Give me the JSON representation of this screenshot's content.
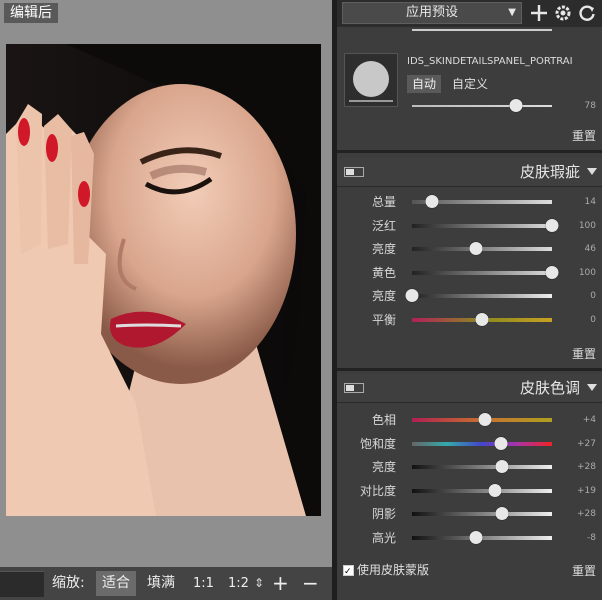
{
  "left": {
    "view_label": "编辑后",
    "zoom_label": "缩放:",
    "zoom_fit": "适合",
    "zoom_fill": "填满",
    "zoom_1_1": "1:1",
    "zoom_1_2": "1:2"
  },
  "toolbar": {
    "preset_label": "应用预设",
    "icons": [
      "plus-icon",
      "gear-icon",
      "refresh-icon"
    ]
  },
  "portrait_panel": {
    "title": "IDS_SKINDETAILSPANEL_PORTRAI",
    "auto_label": "自动",
    "custom_label": "自定义",
    "value": "78",
    "reset_label": "重置"
  },
  "blemish_panel": {
    "title": "皮肤瑕疵",
    "rows": [
      {
        "label": "总量",
        "value": "14",
        "pos": 0.14
      },
      {
        "label": "泛红",
        "value": "100",
        "pos": 1.0
      },
      {
        "label": "亮度",
        "value": "46",
        "pos": 0.46
      },
      {
        "label": "黄色",
        "value": "100",
        "pos": 1.0
      },
      {
        "label": "亮度",
        "value": "0",
        "pos": 0.0
      },
      {
        "label": "平衡",
        "value": "0",
        "pos": 0.5
      }
    ],
    "reset_label": "重置"
  },
  "tone_panel": {
    "title": "皮肤色调",
    "rows": [
      {
        "label": "色相",
        "value": "+4",
        "pos": 0.52
      },
      {
        "label": "饱和度",
        "value": "+27",
        "pos": 0.635
      },
      {
        "label": "亮度",
        "value": "+28",
        "pos": 0.64
      },
      {
        "label": "对比度",
        "value": "+19",
        "pos": 0.595
      },
      {
        "label": "阴影",
        "value": "+28",
        "pos": 0.64
      },
      {
        "label": "高光",
        "value": "-8",
        "pos": 0.46
      }
    ],
    "use_mask_label": "使用皮肤蒙版",
    "reset_label": "重置"
  }
}
